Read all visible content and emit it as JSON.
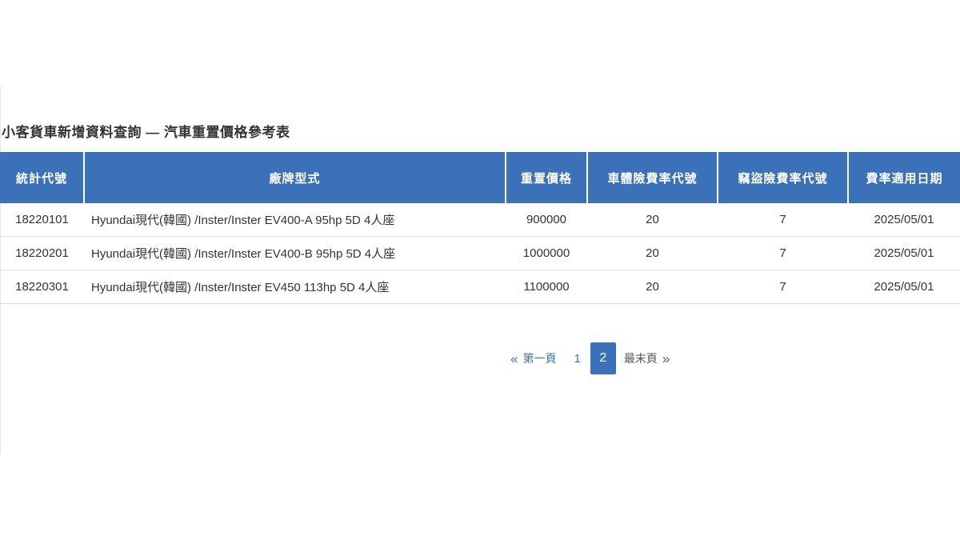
{
  "title": "小客貨車新增資料查詢 — 汽車重置價格參考表",
  "table": {
    "headers": [
      "統計代號",
      "廠牌型式",
      "重置價格",
      "車體險費率代號",
      "竊盜險費率代號",
      "費率適用日期"
    ],
    "rows": [
      [
        "18220101",
        "Hyundai現代(韓國) /Inster/Inster EV400-A 95hp 5D 4人座",
        "900000",
        "20",
        "7",
        "2025/05/01"
      ],
      [
        "18220201",
        "Hyundai現代(韓國) /Inster/Inster EV400-B 95hp 5D 4人座",
        "1000000",
        "20",
        "7",
        "2025/05/01"
      ],
      [
        "18220301",
        "Hyundai現代(韓國) /Inster/Inster EV450 113hp 5D 4人座",
        "1100000",
        "20",
        "7",
        "2025/05/01"
      ]
    ]
  },
  "pagination": {
    "first_label": "第一頁",
    "first_icon": "«",
    "pages": [
      "1",
      "2"
    ],
    "current_page": "2",
    "last_label": "最末頁",
    "last_icon": "»"
  },
  "colors": {
    "header_bg": "#3b71b8",
    "accent": "#3b71b8"
  }
}
